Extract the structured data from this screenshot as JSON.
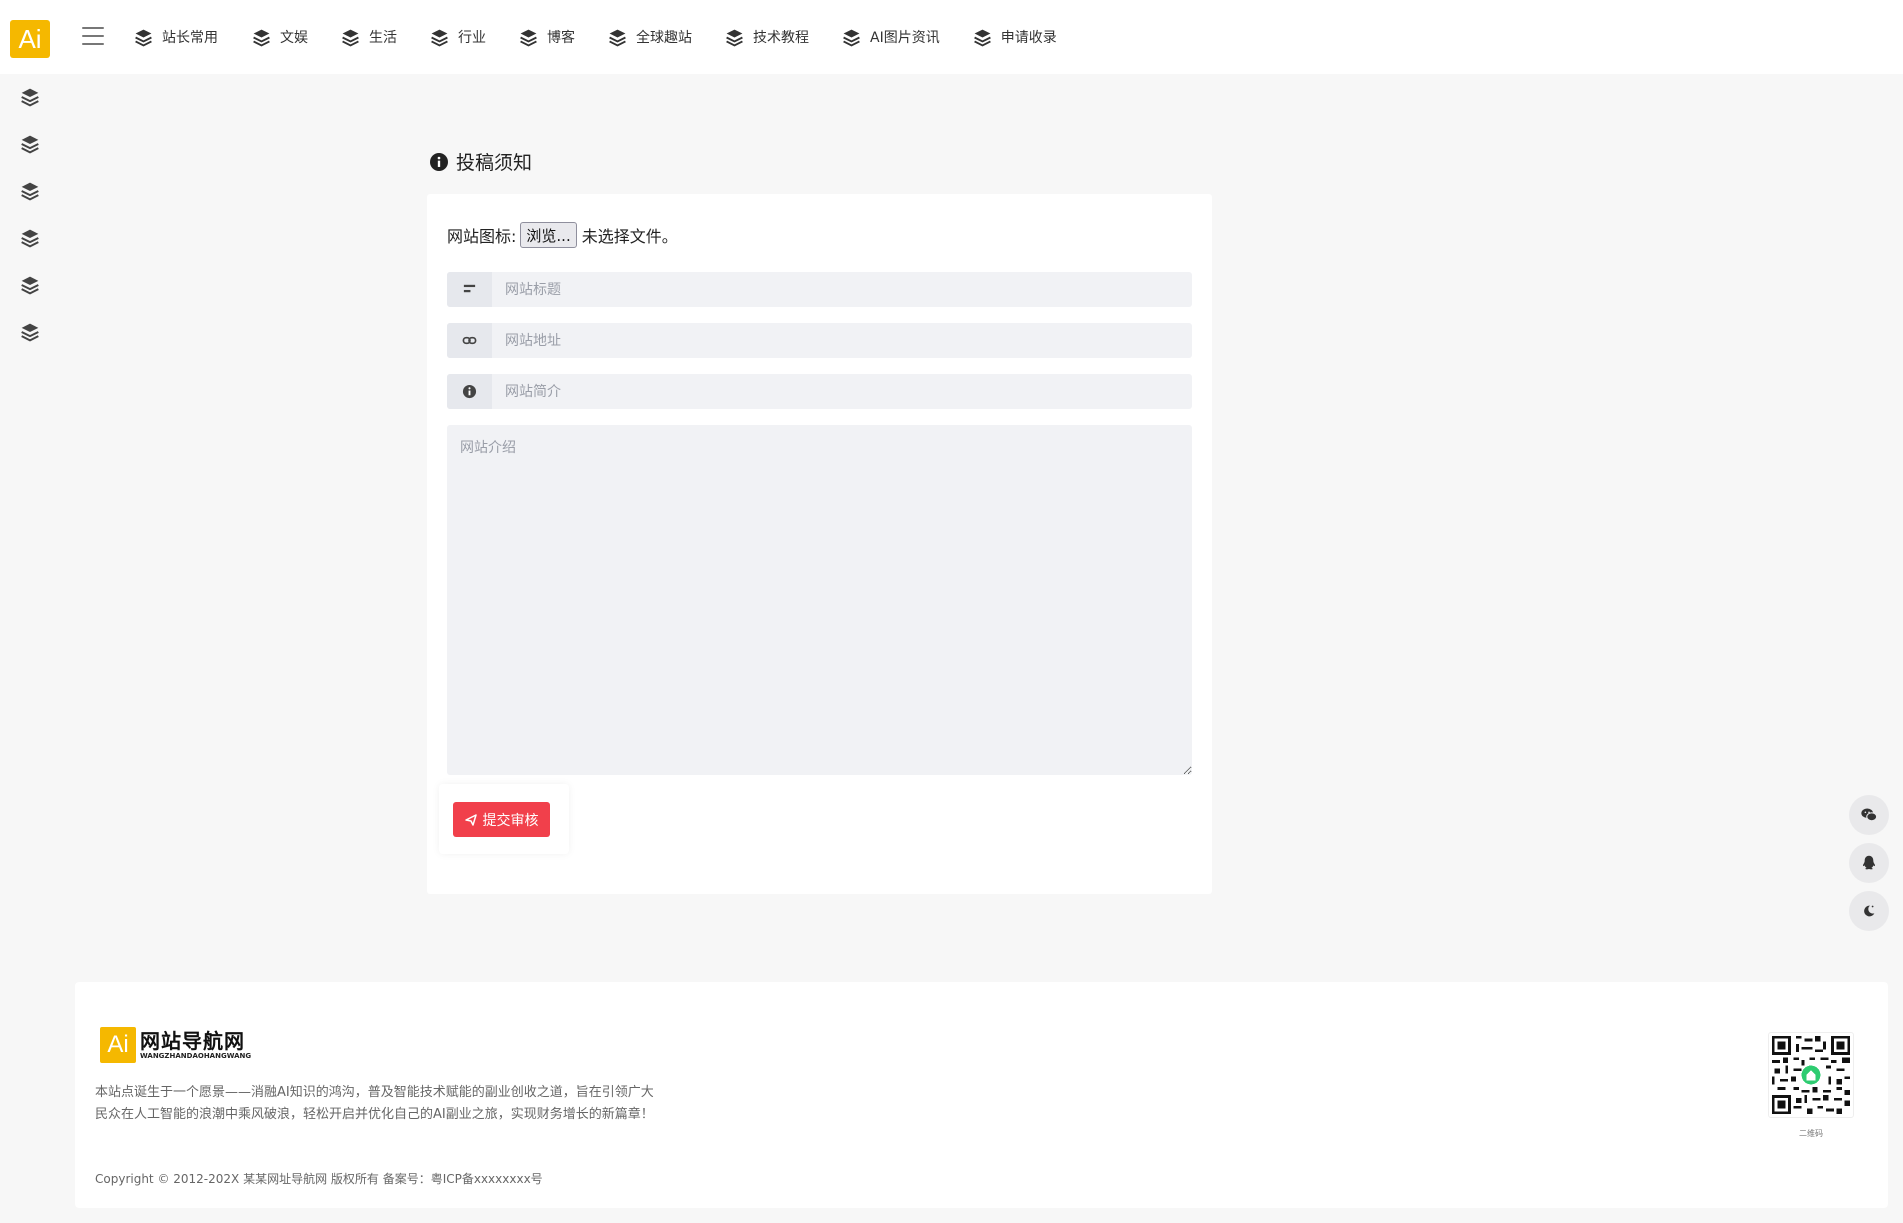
{
  "header": {
    "logo_text": "Ai",
    "nav": [
      {
        "label": "站长常用"
      },
      {
        "label": "文娱"
      },
      {
        "label": "生活"
      },
      {
        "label": "行业"
      },
      {
        "label": "博客"
      },
      {
        "label": "全球趣站"
      },
      {
        "label": "技术教程"
      },
      {
        "label": "AI图片资讯"
      },
      {
        "label": "申请收录"
      }
    ]
  },
  "sidebar": {
    "icons": [
      "layers-icon",
      "layers-icon",
      "layers-icon",
      "layers-icon",
      "layers-icon",
      "layers-icon"
    ]
  },
  "main": {
    "title": "投稿须知",
    "file_label": "网站图标:",
    "browse_label": "浏览...",
    "file_status": "未选择文件。",
    "title_placeholder": "网站标题",
    "url_placeholder": "网站地址",
    "summary_placeholder": "网站简介",
    "intro_placeholder": "网站介绍",
    "submit_label": "提交审核"
  },
  "floating": [
    "wechat-icon",
    "qq-icon",
    "theme-toggle-icon"
  ],
  "footer": {
    "logo_mark": "Ai",
    "logo_cn": "网站导航网",
    "logo_en": "WANGZHANDAOHANGWANG",
    "description": "本站点诞生于一个愿景——消融AI知识的鸿沟，普及智能技术赋能的副业创收之道，旨在引领广大民众在人工智能的浪潮中乘风破浪，轻松开启并优化自己的AI副业之旅，实现财务增长的新篇章！",
    "copyright": "Copyright © 2012-202X 某某网址导航网 版权所有 备案号：粤ICP备xxxxxxxx号",
    "qr_label": "二维码"
  },
  "colors": {
    "brand": "#f5b800",
    "submit": "#f1404b"
  }
}
